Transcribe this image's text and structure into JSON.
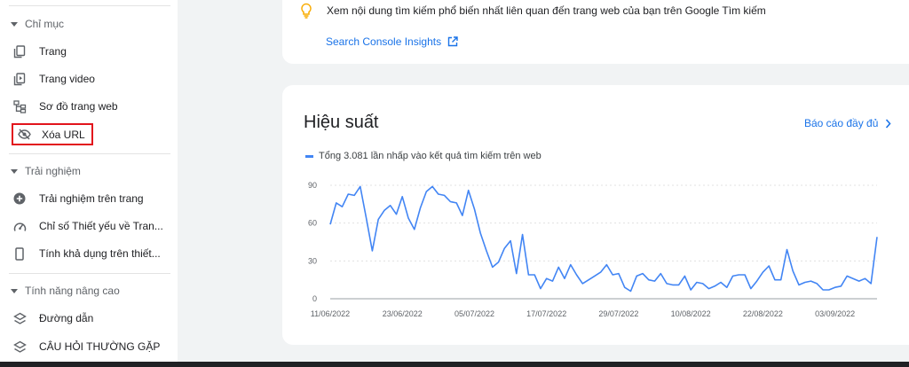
{
  "sidebar": {
    "sections": [
      {
        "label": "Chỉ mục"
      },
      {
        "label": "Trải nghiệm"
      },
      {
        "label": "Tính năng nâng cao"
      }
    ],
    "items": [
      {
        "label": "Trang",
        "icon": "pages-icon"
      },
      {
        "label": "Trang video",
        "icon": "video-pages-icon"
      },
      {
        "label": "Sơ đồ trang web",
        "icon": "sitemap-icon"
      },
      {
        "label": "Xóa URL",
        "icon": "removals-icon",
        "selected": true
      },
      {
        "label": "Trải nghiệm trên trang",
        "icon": "page-experience-icon"
      },
      {
        "label": "Chỉ số Thiết yếu về Tran...",
        "icon": "core-web-vitals-icon"
      },
      {
        "label": "Tính khả dụng trên thiết...",
        "icon": "mobile-usability-icon"
      },
      {
        "label": "Đường dẫn",
        "icon": "breadcrumbs-icon"
      },
      {
        "label": "CÂU HỎI THƯỜNG GẶP",
        "icon": "faq-icon"
      }
    ]
  },
  "insights": {
    "text": "Xem nội dung tìm kiếm phổ biến nhất liên quan đến trang web của bạn trên Google Tìm kiếm",
    "link": "Search Console Insights",
    "icon": "lightbulb-icon"
  },
  "performance": {
    "title": "Hiệu suất",
    "full_report": "Báo cáo đầy đủ",
    "accent_color": "#1a73e8"
  },
  "chart_data": {
    "type": "line",
    "title": "",
    "xlabel": "",
    "ylabel": "",
    "ylim": [
      0,
      90
    ],
    "yticks": [
      0,
      30,
      60,
      90
    ],
    "xticks": [
      "11/06/2022",
      "23/06/2022",
      "05/07/2022",
      "17/07/2022",
      "29/07/2022",
      "10/08/2022",
      "22/08/2022",
      "03/09/2022"
    ],
    "grid": true,
    "legend_position": "top-left",
    "x": [
      "2022-06-11",
      "2022-06-12",
      "2022-06-13",
      "2022-06-14",
      "2022-06-15",
      "2022-06-16",
      "2022-06-17",
      "2022-06-18",
      "2022-06-19",
      "2022-06-20",
      "2022-06-21",
      "2022-06-22",
      "2022-06-23",
      "2022-06-24",
      "2022-06-25",
      "2022-06-26",
      "2022-06-27",
      "2022-06-28",
      "2022-06-29",
      "2022-06-30",
      "2022-07-01",
      "2022-07-02",
      "2022-07-03",
      "2022-07-04",
      "2022-07-05",
      "2022-07-06",
      "2022-07-07",
      "2022-07-08",
      "2022-07-09",
      "2022-07-10",
      "2022-07-11",
      "2022-07-12",
      "2022-07-13",
      "2022-07-14",
      "2022-07-15",
      "2022-07-16",
      "2022-07-17",
      "2022-07-18",
      "2022-07-19",
      "2022-07-20",
      "2022-07-21",
      "2022-07-22",
      "2022-07-23",
      "2022-07-24",
      "2022-07-25",
      "2022-07-26",
      "2022-07-27",
      "2022-07-28",
      "2022-07-29",
      "2022-07-30",
      "2022-07-31",
      "2022-08-01",
      "2022-08-02",
      "2022-08-03",
      "2022-08-04",
      "2022-08-05",
      "2022-08-06",
      "2022-08-07",
      "2022-08-08",
      "2022-08-09",
      "2022-08-10",
      "2022-08-11",
      "2022-08-12",
      "2022-08-13",
      "2022-08-14",
      "2022-08-15",
      "2022-08-16",
      "2022-08-17",
      "2022-08-18",
      "2022-08-19",
      "2022-08-20",
      "2022-08-21",
      "2022-08-22",
      "2022-08-23",
      "2022-08-24",
      "2022-08-25",
      "2022-08-26",
      "2022-08-27",
      "2022-08-28",
      "2022-08-29",
      "2022-08-30",
      "2022-08-31",
      "2022-09-01",
      "2022-09-02",
      "2022-09-03",
      "2022-09-04",
      "2022-09-05",
      "2022-09-06",
      "2022-09-07",
      "2022-09-08",
      "2022-09-09",
      "2022-09-10"
    ],
    "series": [
      {
        "name": "Tổng 3.081 lần nhấp vào kết quả tìm kiếm trên web",
        "color": "#4285f4",
        "values": [
          59,
          76,
          73,
          83,
          82,
          89,
          64,
          38,
          63,
          70,
          74,
          67,
          81,
          64,
          55,
          72,
          85,
          89,
          83,
          82,
          77,
          76,
          66,
          86,
          71,
          52,
          38,
          25,
          29,
          40,
          46,
          20,
          51,
          19,
          19,
          8,
          16,
          14,
          25,
          16,
          27,
          19,
          12,
          15,
          18,
          21,
          27,
          19,
          20,
          9,
          6,
          18,
          20,
          15,
          14,
          20,
          12,
          11,
          11,
          18,
          7,
          13,
          12,
          8,
          10,
          13,
          9,
          18,
          19,
          19,
          8,
          14,
          21,
          26,
          15,
          15,
          39,
          22,
          11,
          13,
          14,
          12,
          7,
          7,
          9,
          10,
          18,
          16,
          14,
          16,
          12,
          49
        ]
      }
    ]
  }
}
